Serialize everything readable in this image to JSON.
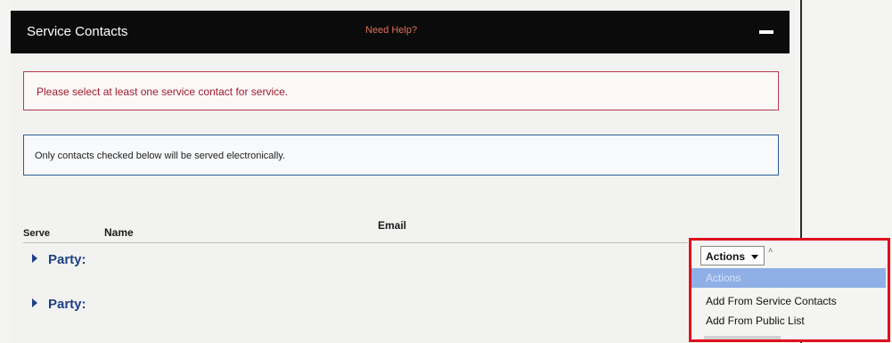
{
  "header": {
    "title": "Service Contacts",
    "help_link": "Need Help?",
    "collapse_icon": "minus-icon"
  },
  "alerts": {
    "error": "Please select at least one service contact for service.",
    "info": "Only contacts checked below will be served electronically."
  },
  "table": {
    "columns": [
      "Serve",
      "Name",
      "Email"
    ],
    "rows": [
      {
        "label": "Party:",
        "expand_icon": "caret-right-icon"
      },
      {
        "label": "Party:",
        "expand_icon": "caret-right-icon"
      }
    ]
  },
  "actions": {
    "button_label": "Actions",
    "menu": [
      {
        "label": "Actions",
        "selected": true
      },
      {
        "label": "Add From Service Contacts",
        "selected": false
      },
      {
        "label": "Add From Public List",
        "selected": false
      }
    ]
  },
  "colors": {
    "header_bg": "#0b0b0b",
    "error_border": "#b83a4e",
    "info_border": "#2a5e91",
    "party_text": "#1f3f88",
    "highlight_border": "#e0101e",
    "menu_selected": "#8fb0e6"
  }
}
